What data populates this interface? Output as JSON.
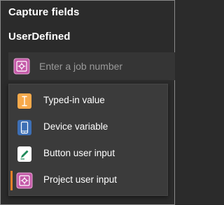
{
  "header": {
    "title": "Capture fields",
    "field_name": "UserDefined"
  },
  "field": {
    "placeholder": "Enter a job number",
    "value": "",
    "icon": "project-user-input-icon"
  },
  "menu": {
    "items": [
      {
        "label": "Typed-in value",
        "icon": "typed-in-value-icon",
        "color": "#f7a94b"
      },
      {
        "label": "Device variable",
        "icon": "device-variable-icon",
        "color": "#3d6fb5"
      },
      {
        "label": "Button user input",
        "icon": "button-user-input-icon",
        "color": "#ffffff"
      },
      {
        "label": "Project user input",
        "icon": "project-user-input-icon",
        "color": "#c459a8",
        "selected": true
      }
    ]
  },
  "colors": {
    "background": "#2b2b2b",
    "accent": "#e8802a",
    "project_input": "#c459a8",
    "typed_value": "#f7a94b",
    "device_variable": "#3d6fb5"
  }
}
